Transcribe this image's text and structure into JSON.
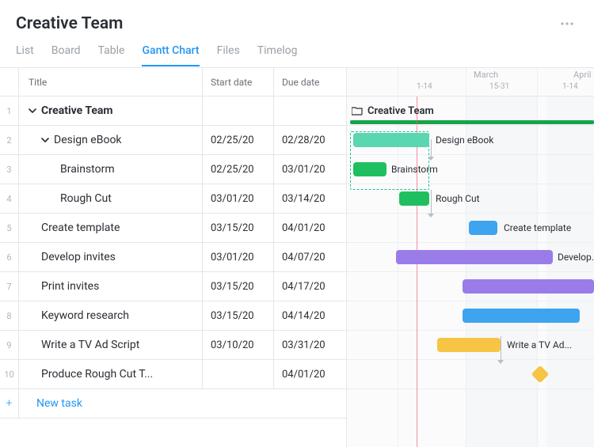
{
  "header": {
    "title": "Creative Team"
  },
  "tabs": {
    "list": "List",
    "board": "Board",
    "table": "Table",
    "gantt": "Gantt Chart",
    "files": "Files",
    "timelog": "Timelog"
  },
  "columns": {
    "title": "Title",
    "start": "Start date",
    "due": "Due date"
  },
  "timeline": {
    "month1": "March",
    "month2": "April",
    "range1": "1-14",
    "range2": "15-31",
    "range3": "1-14"
  },
  "group": {
    "name": "Creative Team"
  },
  "rows": [
    {
      "num": "1",
      "title": "Creative Team",
      "start": "",
      "due": "",
      "indent": 0,
      "caret": true,
      "bold": true
    },
    {
      "num": "2",
      "title": "Design eBook",
      "start": "02/25/20",
      "due": "02/28/20",
      "indent": 1,
      "caret": true
    },
    {
      "num": "3",
      "title": "Brainstorm",
      "start": "02/25/20",
      "due": "03/01/20",
      "indent": 2
    },
    {
      "num": "4",
      "title": "Rough Cut",
      "start": "03/01/20",
      "due": "03/14/20",
      "indent": 2
    },
    {
      "num": "5",
      "title": "Create template",
      "start": "03/15/20",
      "due": "04/01/20",
      "indent": 1
    },
    {
      "num": "6",
      "title": "Develop invites",
      "start": "03/01/20",
      "due": "04/07/20",
      "indent": 1
    },
    {
      "num": "7",
      "title": "Print invites",
      "start": "03/15/20",
      "due": "04/17/20",
      "indent": 1
    },
    {
      "num": "8",
      "title": "Keyword research",
      "start": "03/15/20",
      "due": "04/14/20",
      "indent": 1
    },
    {
      "num": "9",
      "title": "Write a TV Ad Script",
      "start": "03/10/20",
      "due": "03/31/20",
      "indent": 1
    },
    {
      "num": "10",
      "title": "Produce Rough Cut T...",
      "start": "",
      "due": "04/01/20",
      "indent": 1
    }
  ],
  "newtask": {
    "label": "New task"
  },
  "bars": {
    "design_ebook": "Design eBook",
    "brainstorm": "Brainstorm",
    "rough_cut": "Rough Cut",
    "create_template": "Create template",
    "develop": "Develop...",
    "write_tv": "Write a TV Ad..."
  },
  "colors": {
    "teal": "#5ad6b0",
    "green": "#1fbf60",
    "blue": "#3ea4f0",
    "purple": "#9a7ce8",
    "yellow": "#f6c544"
  }
}
